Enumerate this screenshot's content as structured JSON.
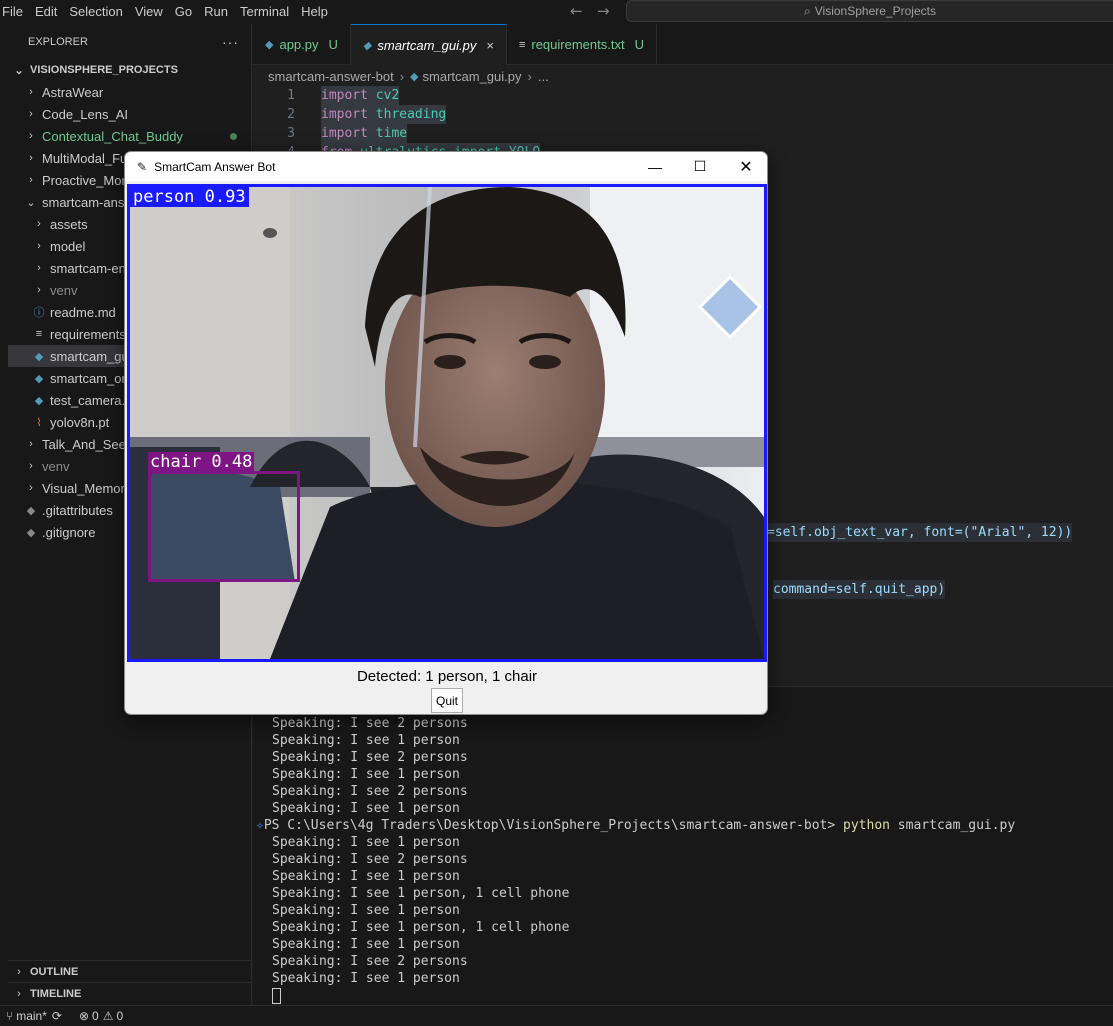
{
  "menu": [
    "File",
    "Edit",
    "Selection",
    "View",
    "Go",
    "Run",
    "Terminal",
    "Help"
  ],
  "search": {
    "label": "VisionSphere_Projects",
    "icon": "search-icon"
  },
  "explorer": {
    "title": "EXPLORER",
    "more": "···",
    "root": "VISIONSPHERE_PROJECTS",
    "items": [
      {
        "label": "AstraWear",
        "kind": "folder-collapsed"
      },
      {
        "label": "Code_Lens_AI",
        "kind": "folder-collapsed"
      },
      {
        "label": "Contextual_Chat_Buddy",
        "kind": "folder-collapsed"
      },
      {
        "label": "MultiModal_Fu",
        "kind": "folder-collapsed"
      },
      {
        "label": "Proactive_Mon",
        "kind": "folder-collapsed"
      },
      {
        "label": "smartcam-ans",
        "kind": "folder-expanded"
      },
      {
        "label": "assets",
        "kind": "folder-collapsed"
      },
      {
        "label": "model",
        "kind": "folder-collapsed"
      },
      {
        "label": "smartcam-en",
        "kind": "folder-collapsed"
      },
      {
        "label": "venv",
        "kind": "folder-collapsed"
      },
      {
        "label": "readme.md",
        "kind": "info-file"
      },
      {
        "label": "requirements",
        "kind": "text-file"
      },
      {
        "label": "smartcam_gu",
        "kind": "python-file"
      },
      {
        "label": "smartcam_or",
        "kind": "python-file"
      },
      {
        "label": "test_camera.",
        "kind": "python-file"
      },
      {
        "label": "yolov8n.pt",
        "kind": "torch-file"
      },
      {
        "label": "Talk_And_See_",
        "kind": "folder-collapsed"
      },
      {
        "label": "venv",
        "kind": "folder-collapsed"
      },
      {
        "label": "Visual_Memor",
        "kind": "folder-collapsed"
      },
      {
        "label": ".gitattributes",
        "kind": "git-file"
      },
      {
        "label": ".gitignore",
        "kind": "git-file"
      }
    ],
    "outline": "OUTLINE",
    "timeline": "TIMELINE"
  },
  "tabs": [
    {
      "label": "app.py",
      "badge": "U",
      "state": "untracked"
    },
    {
      "label": "smartcam_gui.py",
      "badge": "×",
      "state": "active"
    },
    {
      "label": "requirements.txt",
      "badge": "U",
      "state": "untracked"
    }
  ],
  "breadcrumb": {
    "folder": "smartcam-answer-bot",
    "file": "smartcam_gui.py",
    "more": "..."
  },
  "code": {
    "lines": [
      {
        "num": "1",
        "kw": "import",
        "rest": "cv2"
      },
      {
        "num": "2",
        "kw": "import",
        "rest": "threading"
      },
      {
        "num": "3",
        "kw": "import",
        "rest": "time"
      },
      {
        "num": "4",
        "kw": "from",
        "rest": "ultralytics import YOLO"
      }
    ],
    "fragment1": "=self.obj_text_var, font=(\"Arial\", 12))",
    "fragment2": "command=self.quit_app)"
  },
  "terminal": {
    "lines_before": [
      "Speaking: I see 2 persons",
      "Speaking: I see 1 person",
      "Speaking: I see 2 persons",
      "Speaking: I see 1 person",
      "Speaking: I see 2 persons",
      "Speaking: I see 1 person"
    ],
    "prompt": "PS C:\\Users\\4g Traders\\Desktop\\VisionSphere_Projects\\smartcam-answer-bot>",
    "command": "python",
    "command_arg": "smartcam_gui.py",
    "lines_after": [
      "Speaking: I see 1 person",
      "Speaking: I see 2 persons",
      "Speaking: I see 1 person",
      "Speaking: I see 1 person, 1 cell phone",
      "Speaking: I see 1 person",
      "Speaking: I see 1 person, 1 cell phone",
      "Speaking: I see 1 person",
      "Speaking: I see 2 persons",
      "Speaking: I see 1 person"
    ]
  },
  "statusbar": {
    "branch": "main*",
    "errors": "0",
    "warnings": "0"
  },
  "app_window": {
    "title": "SmartCam Answer Bot",
    "detections": [
      {
        "label": "person 0.93",
        "color": "#1a1aff"
      },
      {
        "label": "chair 0.48",
        "color": "#7f1584"
      }
    ],
    "detected_text": "Detected: 1 person, 1 chair",
    "quit_label": "Quit"
  }
}
